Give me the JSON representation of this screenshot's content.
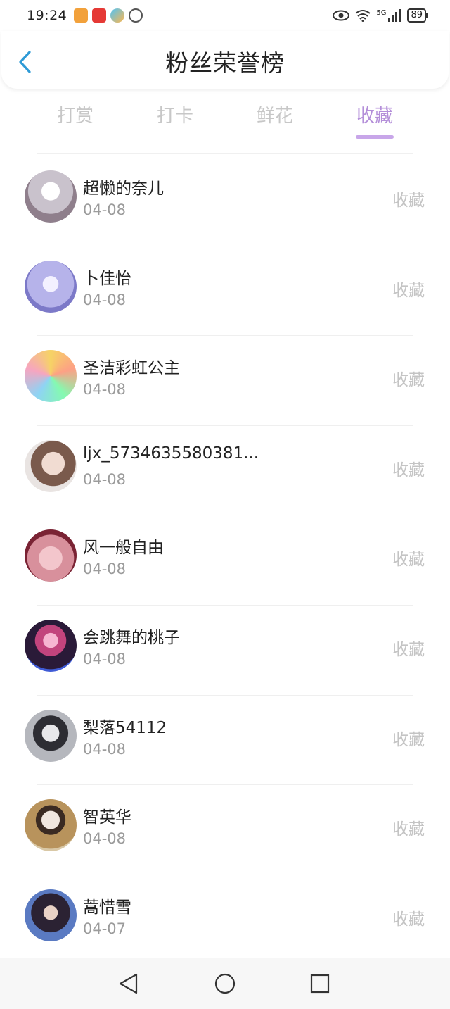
{
  "status_bar": {
    "time": "19:24",
    "network": "5G",
    "battery": "89"
  },
  "header": {
    "title": "粉丝荣誉榜",
    "back_icon": "chevron-left-icon"
  },
  "tabs": [
    {
      "label": "打赏",
      "active": false
    },
    {
      "label": "打卡",
      "active": false
    },
    {
      "label": "鲜花",
      "active": false
    },
    {
      "label": "收藏",
      "active": true
    }
  ],
  "fans": [
    {
      "name": "超懒的奈儿",
      "date": "04-08",
      "action": "收藏",
      "avatar_color": "#d9d4dc"
    },
    {
      "name": "卜佳怡",
      "date": "04-08",
      "action": "收藏",
      "avatar_color": "#b9b8e8"
    },
    {
      "name": "圣洁彩虹公主",
      "date": "04-08",
      "action": "收藏",
      "avatar_color": "#e8c96a"
    },
    {
      "name": "ljx_5734635580381...",
      "date": "04-08",
      "action": "收藏",
      "avatar_color": "#d8c2b6"
    },
    {
      "name": "风一般自由",
      "date": "04-08",
      "action": "收藏",
      "avatar_color": "#d47d8e"
    },
    {
      "name": "会跳舞的桃子",
      "date": "04-08",
      "action": "收藏",
      "avatar_color": "#2c1f3e"
    },
    {
      "name": "梨落54112",
      "date": "04-08",
      "action": "收藏",
      "avatar_color": "#9c9ea6"
    },
    {
      "name": "智英华",
      "date": "04-08",
      "action": "收藏",
      "avatar_color": "#b89a6e"
    },
    {
      "name": "蒿惜雪",
      "date": "04-07",
      "action": "收藏",
      "avatar_color": "#3b3350"
    }
  ],
  "colors": {
    "accent": "#b48fd9",
    "indicator": "#c8a6e9",
    "back_icon": "#2f9bd6"
  }
}
